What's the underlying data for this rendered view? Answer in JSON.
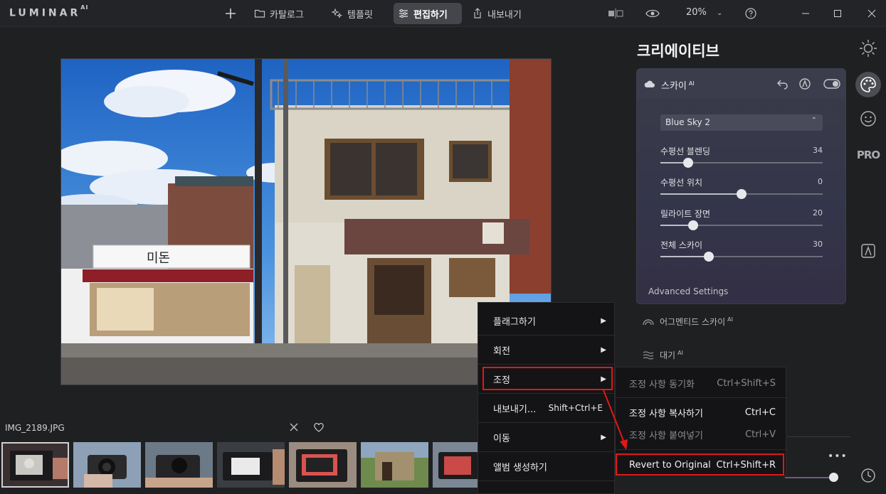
{
  "app": {
    "logo": "LUMINAR",
    "logo_suffix": "AI"
  },
  "toolbar": {
    "catalog": "카탈로그",
    "templates": "템플릿",
    "edit": "편집하기",
    "export": "내보내기",
    "zoom": "20%"
  },
  "panel": {
    "title": "크리에이티브",
    "sky": {
      "title": "스카이",
      "ai": "AI",
      "preset": "Blue Sky 2",
      "sliders": [
        {
          "label": "수평선 블렌딩",
          "value": "34",
          "level": 0.17
        },
        {
          "label": "수평선 위치",
          "value": "0",
          "level": 0.5
        },
        {
          "label": "릴라이트 장면",
          "value": "20",
          "level": 0.2
        },
        {
          "label": "전체 스카이",
          "value": "30",
          "level": 0.3
        }
      ],
      "advanced": "Advanced Settings"
    },
    "augmented_sky": "어그멘티드 스카이",
    "atmosphere": "대기",
    "ai": "AI"
  },
  "filmstrip": {
    "filename": "IMG_2189.JPG"
  },
  "context_menu": {
    "items": [
      {
        "label": "플래그하기",
        "shortcut": ""
      },
      {
        "label": "회전",
        "shortcut": ""
      },
      {
        "label": "조정",
        "shortcut": ""
      },
      {
        "label": "내보내기...",
        "shortcut": "Shift+Ctrl+E"
      },
      {
        "label": "이동",
        "shortcut": ""
      },
      {
        "label": "앨범 생성하기",
        "shortcut": ""
      }
    ],
    "submenu": [
      {
        "label": "조정 사항 동기화",
        "shortcut": "Ctrl+Shift+S"
      },
      {
        "label": "조정 사항 복사하기",
        "shortcut": "Ctrl+C"
      },
      {
        "label": "조정 사항 붙여넣기",
        "shortcut": "Ctrl+V"
      },
      {
        "label": "Revert to Original",
        "shortcut": "Ctrl+Shift+R"
      }
    ]
  },
  "colors": {
    "highlight": "#e11818",
    "accent": "#45464b"
  }
}
